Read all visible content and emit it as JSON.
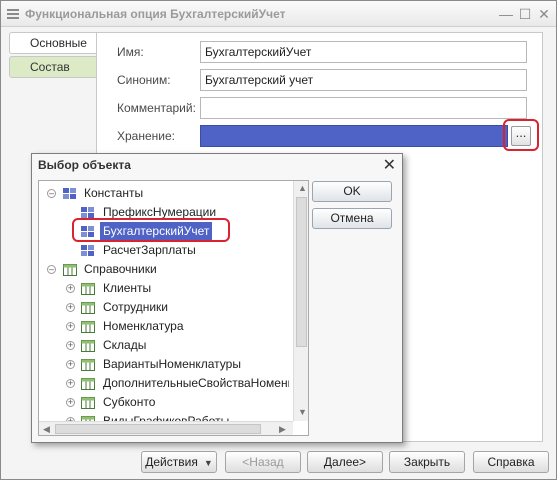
{
  "window": {
    "title": "Функциональная опция БухгалтерскийУчет",
    "controls": {
      "minimize": "—",
      "maximize": "☐",
      "close": "✕"
    }
  },
  "tabs": [
    {
      "label": "Основные"
    },
    {
      "label": "Состав"
    }
  ],
  "form": {
    "name_label": "Имя:",
    "name_value": "БухгалтерскийУчет",
    "synonym_label": "Синоним:",
    "synonym_value": "Бухгалтерский учет",
    "comment_label": "Комментарий:",
    "comment_value": "",
    "storage_label": "Хранение:",
    "storage_value": "",
    "storage_select_button": "..."
  },
  "dialog": {
    "title": "Выбор объекта",
    "close": "✕",
    "ok_label": "OK",
    "cancel_label": "Отмена",
    "tree": [
      {
        "label": "Константы"
      },
      {
        "label": "ПрефиксНумерации"
      },
      {
        "label": "БухгалтерскийУчет"
      },
      {
        "label": "РасчетЗарплаты"
      },
      {
        "label": "Справочники"
      },
      {
        "label": "Клиенты"
      },
      {
        "label": "Сотрудники"
      },
      {
        "label": "Номенклатура"
      },
      {
        "label": "Склады"
      },
      {
        "label": "ВариантыНоменклатуры"
      },
      {
        "label": "ДополнительныеСвойстваНоменкла"
      },
      {
        "label": "Субконто"
      },
      {
        "label": "ВидыГрафиковРаботы"
      }
    ]
  },
  "bottom": {
    "actions_label": "Действия",
    "back_label": "<Назад",
    "next_label": "Далее>",
    "close_label": "Закрыть",
    "help_label": "Справка"
  },
  "colors": {
    "accent_blue": "#4f63c6",
    "highlight_red": "#d9232f",
    "inactive_tab_green": "#dcebc6"
  }
}
